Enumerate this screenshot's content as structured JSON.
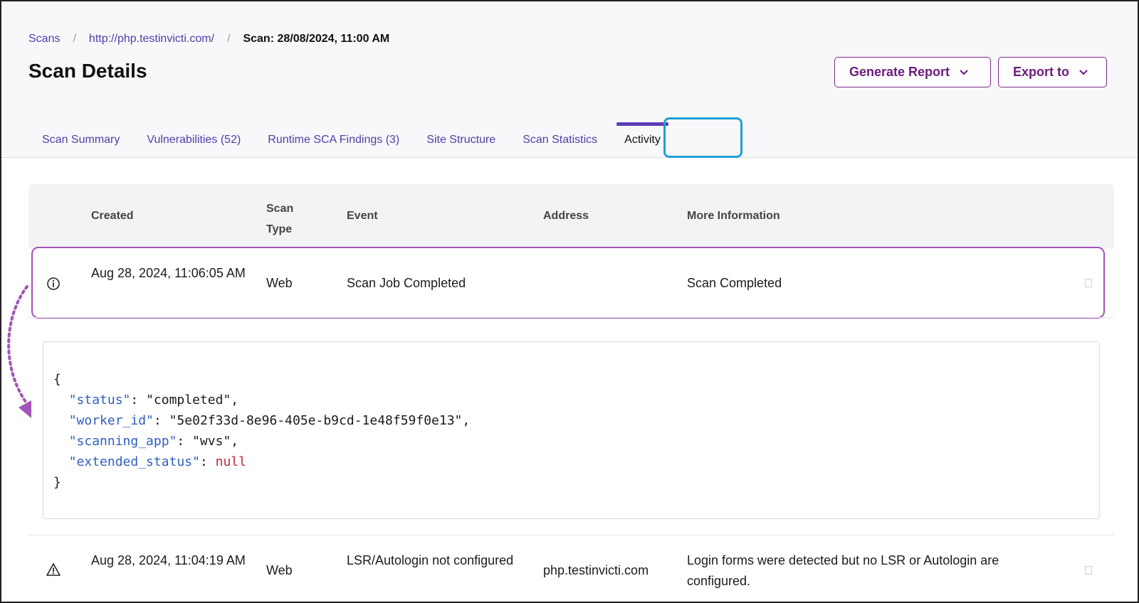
{
  "breadcrumb": {
    "items": [
      "Scans",
      "http://php.testinvicti.com/"
    ],
    "current": "Scan: 28/08/2024, 11:00 AM"
  },
  "page_title": "Scan Details",
  "actions": {
    "generate_report": "Generate Report",
    "export_to": "Export to"
  },
  "tabs": [
    {
      "label": "Scan Summary"
    },
    {
      "label": "Vulnerabilities (52)"
    },
    {
      "label": "Runtime SCA Findings (3)"
    },
    {
      "label": "Site Structure"
    },
    {
      "label": "Scan Statistics"
    },
    {
      "label": "Activity",
      "active": true
    }
  ],
  "table": {
    "headers": {
      "created": "Created",
      "scan_type": "Scan Type",
      "event": "Event",
      "address": "Address",
      "more_info": "More Information"
    },
    "rows": [
      {
        "icon": "info-icon",
        "created": "Aug 28, 2024, 11:06:05 AM",
        "scan_type": "Web",
        "event": "Scan Job Completed",
        "address": "",
        "more_info": "Scan Completed",
        "expanded": true
      },
      {
        "icon": "warning-icon",
        "created": "Aug 28, 2024, 11:04:19 AM",
        "scan_type": "Web",
        "event": "LSR/Autologin not configured",
        "address": "php.testinvicti.com",
        "more_info": "Login forms were detected but no LSR or Autologin are configured."
      }
    ]
  },
  "json_detail": {
    "open": "{",
    "close": "}",
    "lines": [
      {
        "key": "\"status\"",
        "value": "\"completed\"",
        "suffix": ","
      },
      {
        "key": "\"worker_id\"",
        "value": "\"5e02f33d-8e96-405e-b9cd-1e48f59f0e13\"",
        "suffix": ","
      },
      {
        "key": "\"scanning_app\"",
        "value": "\"wvs\"",
        "suffix": ","
      },
      {
        "key": "\"extended_status\"",
        "value": "null",
        "suffix": ""
      }
    ]
  },
  "colors": {
    "accent": "#6a1b7c",
    "link": "#4b3fa8",
    "active_tab_bar": "#5b3db5",
    "focus_ring": "#1fa0d6",
    "row_highlight": "#a453b8",
    "json_key": "#2f5fbf",
    "json_null": "#c0283a"
  }
}
